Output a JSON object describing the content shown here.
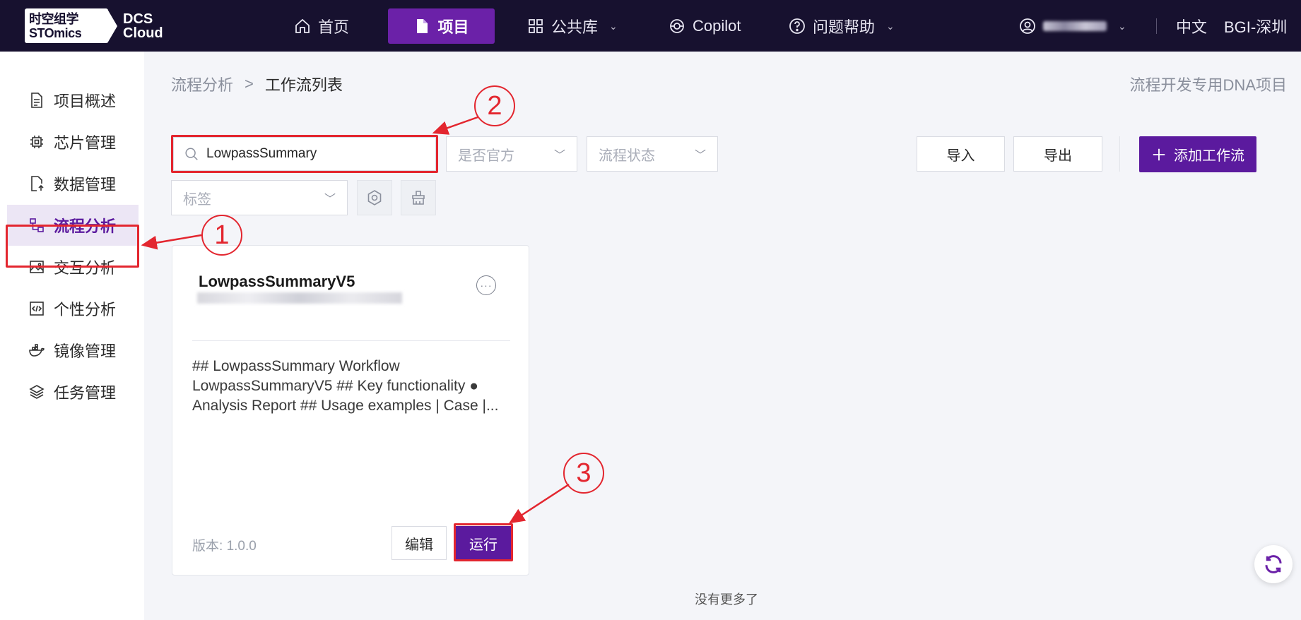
{
  "topbar": {
    "logo_line1": "时空组学",
    "logo_line2": "STOmics",
    "logo_dcs_line1": "DCS",
    "logo_dcs_line2": "Cloud",
    "nav": [
      {
        "label": "首页",
        "icon": "home-icon"
      },
      {
        "label": "项目",
        "icon": "file-icon"
      },
      {
        "label": "公共库",
        "icon": "grid-icon"
      },
      {
        "label": "Copilot",
        "icon": "copilot-icon"
      },
      {
        "label": "问题帮助",
        "icon": "help-icon"
      }
    ],
    "language": "中文",
    "region": "BGI-深圳"
  },
  "sidebar": {
    "items": [
      {
        "label": "项目概述",
        "icon": "document-icon"
      },
      {
        "label": "芯片管理",
        "icon": "chip-icon"
      },
      {
        "label": "数据管理",
        "icon": "data-upload-icon"
      },
      {
        "label": "流程分析",
        "icon": "workflow-icon"
      },
      {
        "label": "交互分析",
        "icon": "image-icon"
      },
      {
        "label": "个性分析",
        "icon": "code-icon"
      },
      {
        "label": "镜像管理",
        "icon": "docker-icon"
      },
      {
        "label": "任务管理",
        "icon": "layers-icon"
      }
    ]
  },
  "breadcrumb": {
    "parent": "流程分析",
    "separator": ">",
    "current": "工作流列表"
  },
  "project_name": "流程开发专用DNA项目",
  "filters": {
    "search_value": "LowpassSummary",
    "official_placeholder": "是否官方",
    "status_placeholder": "流程状态",
    "tag_placeholder": "标签"
  },
  "actions": {
    "import_label": "导入",
    "export_label": "导出",
    "add_label": "添加工作流"
  },
  "card": {
    "title": "LowpassSummaryV5",
    "description": "## LowpassSummary Workflow LowpassSummaryV5 ## Key functionality ● Analysis Report ## Usage examples | Case |...",
    "version_label": "版本:",
    "version_value": "1.0.0",
    "edit_label": "编辑",
    "run_label": "运行",
    "more_label": "···"
  },
  "footer": {
    "no_more": "没有更多了"
  },
  "annotations": {
    "step1": "1",
    "step2": "2",
    "step3": "3",
    "color": "#e3262f"
  },
  "colors": {
    "topbar_bg": "#17112f",
    "accent": "#5b1a9e",
    "active_nav": "#6b21a8"
  }
}
